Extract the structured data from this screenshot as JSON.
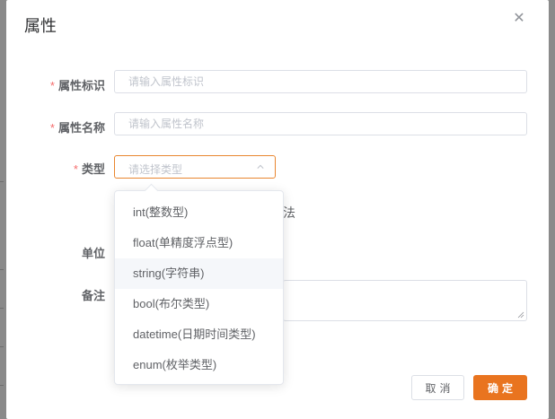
{
  "dialog": {
    "title": "属性",
    "close_glyph": "✕"
  },
  "form": {
    "identifier": {
      "label": "属性标识",
      "placeholder": "请输入属性标识",
      "required": true
    },
    "name": {
      "label": "属性名称",
      "placeholder": "请输入属性名称",
      "required": true
    },
    "type": {
      "label": "类型",
      "placeholder": "请选择类型",
      "required": true,
      "open": true
    },
    "partial_text": "法",
    "unit": {
      "label": "单位"
    },
    "remark": {
      "label": "备注"
    },
    "required_mark": "*"
  },
  "type_options": [
    "int(整数型)",
    "float(单精度浮点型)",
    "string(字符串)",
    "bool(布尔类型)",
    "datetime(日期时间类型)",
    "enum(枚举类型)"
  ],
  "hovered_option_index": 2,
  "footer": {
    "cancel_label": "取消",
    "ok_label": "确定"
  },
  "colors": {
    "accent": "#e9741f",
    "required": "#f56c6c",
    "overlay": "#8a8a8a"
  }
}
